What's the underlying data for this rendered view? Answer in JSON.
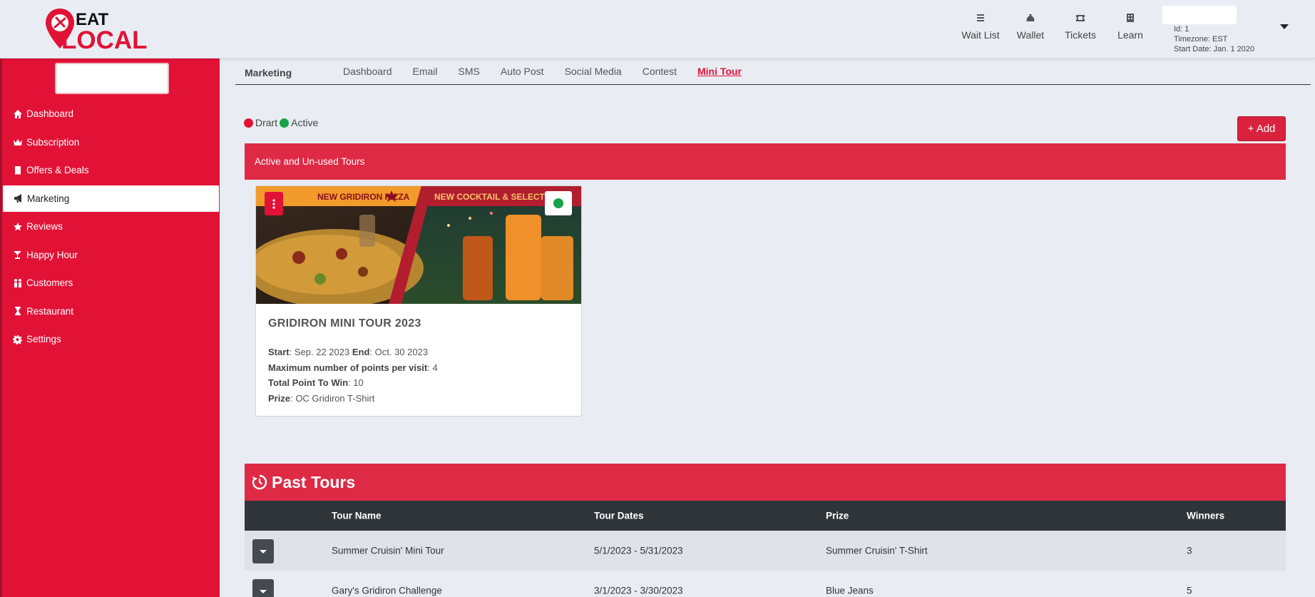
{
  "brand": {
    "logo_line1": "EAT",
    "logo_line2": "LOCAL"
  },
  "top_nav": [
    {
      "label": "Wait List",
      "icon": "list-icon"
    },
    {
      "label": "Wallet",
      "icon": "money-bag-icon"
    },
    {
      "label": "Tickets",
      "icon": "ticket-icon"
    },
    {
      "label": "Learn",
      "icon": "building-icon"
    }
  ],
  "user": {
    "id": "Id: 1",
    "timezone": "Timezone: EST",
    "start_date": "Start Date: Jan. 1 2020"
  },
  "sidebar": {
    "items": [
      {
        "label": "Dashboard",
        "icon": "home-icon"
      },
      {
        "label": "Subscription",
        "icon": "crown-icon"
      },
      {
        "label": "Offers & Deals",
        "icon": "receipt-icon"
      },
      {
        "label": "Marketing",
        "icon": "megaphone-icon",
        "active": true
      },
      {
        "label": "Reviews",
        "icon": "star-icon"
      },
      {
        "label": "Happy Hour",
        "icon": "cocktail-icon"
      },
      {
        "label": "Customers",
        "icon": "users-icon"
      },
      {
        "label": "Restaurant",
        "icon": "chef-icon"
      },
      {
        "label": "Settings",
        "icon": "gear-icon"
      }
    ]
  },
  "subnav": {
    "title": "Marketing",
    "tabs": [
      "Dashboard",
      "Email",
      "SMS",
      "Auto Post",
      "Social Media",
      "Contest",
      "Mini Tour"
    ],
    "active_tab": "Mini Tour"
  },
  "legend": {
    "draft": "Drart",
    "active": "Active",
    "draft_color": "#e21237",
    "active_color": "#16a34a"
  },
  "add_button": "+ Add",
  "active_section": {
    "title": "Active and Un-used Tours"
  },
  "tour": {
    "banner_left": "NEW GRIDIRON PIZZA",
    "banner_right": "NEW COCKTAIL & SELECTED",
    "title": "GRIDIRON MINI TOUR 2023",
    "start_label": "Start",
    "start": "Sep. 22 2023",
    "end_label": "End",
    "end": "Oct. 30 2023",
    "max_points_label": "Maximum number of points per visit",
    "max_points": "4",
    "total_points_label": "Total Point To Win",
    "total_points": "10",
    "prize_label": "Prize",
    "prize": "OC Gridiron T-Shirt",
    "status": "active"
  },
  "past_tours": {
    "title": "Past Tours",
    "columns": [
      "Tour Name",
      "Tour Dates",
      "Prize",
      "Winners"
    ],
    "rows": [
      {
        "name": "Summer Cruisin' Mini Tour",
        "dates": "5/1/2023 - 5/31/2023",
        "prize": "Summer Cruisin' T-Shirt",
        "winners": "3"
      },
      {
        "name": "Gary's Gridiron Challenge",
        "dates": "3/1/2023 - 3/30/2023",
        "prize": "Blue Jeans",
        "winners": "5"
      }
    ]
  },
  "colors": {
    "brand_red": "#e21237",
    "header_dark": "#30353a",
    "bg": "#e9edf3"
  }
}
